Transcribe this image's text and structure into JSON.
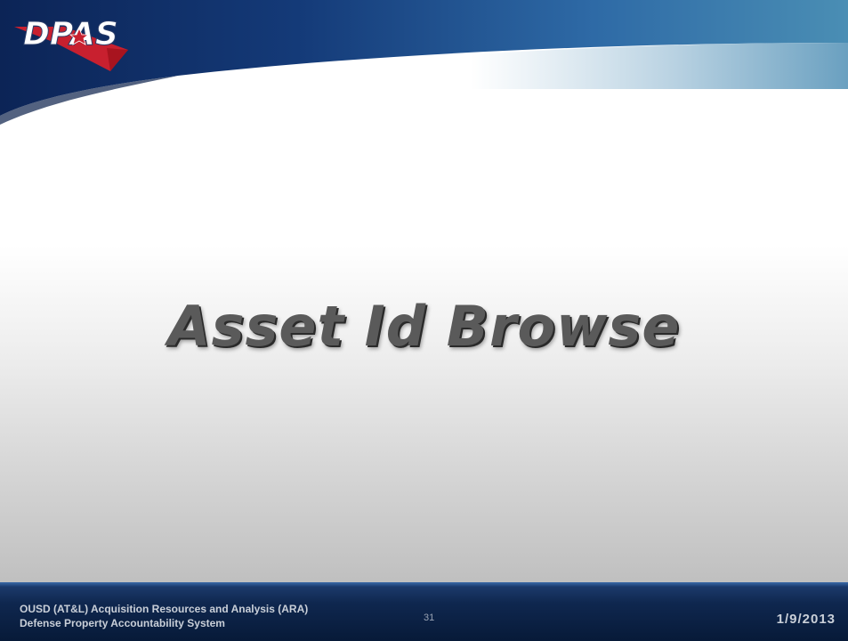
{
  "logo": {
    "text": "DPAS",
    "icon": "dpas-star-logo-icon"
  },
  "slide": {
    "title": "Asset Id Browse"
  },
  "footer": {
    "org_line_1": "OUSD (AT&L) Acquisition Resources and Analysis (ARA)",
    "org_line_2": "Defense Property Accountability System",
    "page_number": "31",
    "date": "1/9/2013"
  },
  "colors": {
    "header_navy": "#0e2a5c",
    "header_teal": "#4d8fb0",
    "logo_red": "#c8202f",
    "footer_navy": "#0f274f",
    "title_gray": "#5a5a5a"
  }
}
